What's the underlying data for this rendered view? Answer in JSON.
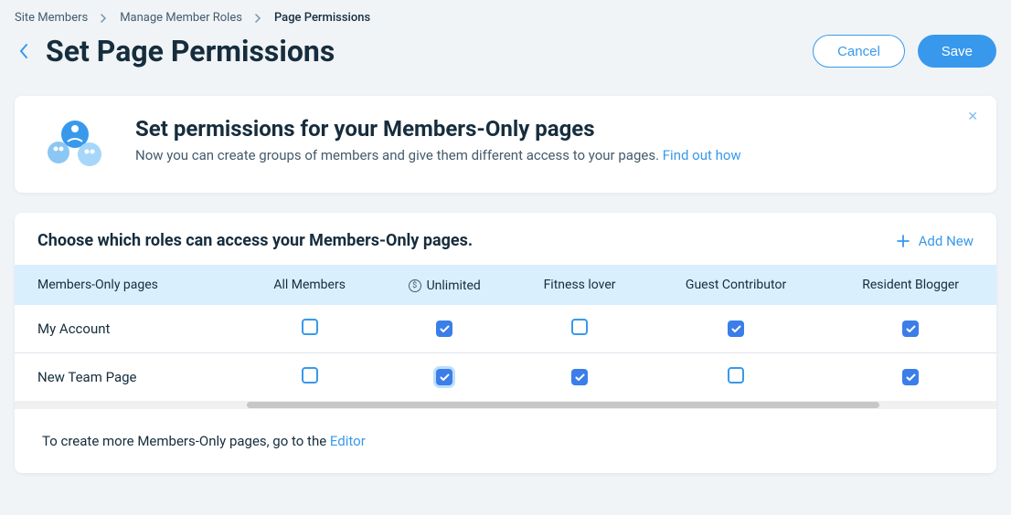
{
  "breadcrumb": {
    "items": [
      "Site Members",
      "Manage Member Roles",
      "Page Permissions"
    ]
  },
  "header": {
    "title": "Set Page Permissions",
    "cancel": "Cancel",
    "save": "Save"
  },
  "info": {
    "title": "Set permissions for your Members-Only pages",
    "body_prefix": "Now you can create groups of members and give them different access to your pages. ",
    "link": "Find out how"
  },
  "table": {
    "heading": "Choose which roles can access your Members-Only pages.",
    "add_new": "Add New",
    "columns": {
      "pages": "Members-Only pages",
      "all": "All Members",
      "roles": [
        "Unlimited",
        "Fitness lover",
        "Guest Contributor",
        "Resident Blogger"
      ],
      "role_has_icon": [
        true,
        false,
        false,
        false
      ]
    },
    "rows": [
      {
        "page": "My Account",
        "all": false,
        "cells": [
          true,
          false,
          true,
          true
        ],
        "focus": [
          false,
          false,
          false,
          false
        ]
      },
      {
        "page": "New Team Page",
        "all": false,
        "cells": [
          true,
          true,
          false,
          true
        ],
        "focus": [
          true,
          false,
          false,
          false
        ]
      }
    ]
  },
  "footer": {
    "text_prefix": "To create more Members-Only pages, go to the ",
    "link": "Editor"
  }
}
